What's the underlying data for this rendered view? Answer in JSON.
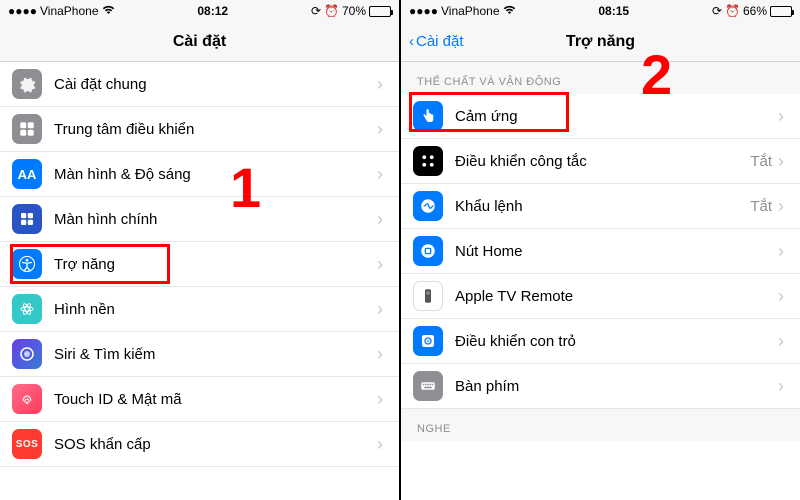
{
  "left": {
    "status": {
      "carrier": "VinaPhone",
      "time": "08:12",
      "battery_pct": "70%",
      "battery_level": 70
    },
    "nav": {
      "title": "Cài đặt"
    },
    "rows": [
      {
        "icon": "gear-icon",
        "iconClass": "icon-gray",
        "label": "Cài đặt chung"
      },
      {
        "icon": "control-center-icon",
        "iconClass": "icon-gray",
        "label": "Trung tâm điều khiển"
      },
      {
        "icon": "display-icon",
        "iconClass": "icon-blue",
        "label": "Màn hình & Độ sáng",
        "aa": true
      },
      {
        "icon": "home-screen-icon",
        "iconClass": "icon-darkblue",
        "label": "Màn hình chính"
      },
      {
        "icon": "accessibility-icon",
        "iconClass": "icon-blue",
        "label": "Trợ năng",
        "hl": true
      },
      {
        "icon": "wallpaper-icon",
        "iconClass": "icon-teal",
        "label": "Hình nền"
      },
      {
        "icon": "siri-icon",
        "iconClass": "icon-siri",
        "label": "Siri & Tìm kiếm"
      },
      {
        "icon": "touchid-icon",
        "iconClass": "icon-touch",
        "label": "Touch ID & Mật mã"
      },
      {
        "icon": "sos-icon",
        "iconClass": "icon-red",
        "label": "SOS khẩn cấp",
        "sos": true
      }
    ],
    "callout": "1"
  },
  "right": {
    "status": {
      "carrier": "VinaPhone",
      "time": "08:15",
      "battery_pct": "66%",
      "battery_level": 66
    },
    "nav": {
      "title": "Trợ năng",
      "back": "Cài đặt"
    },
    "section1": "THỂ CHẤT VÀ VẬN ĐỘNG",
    "rows1": [
      {
        "icon": "touch-icon",
        "iconClass": "icon-blue",
        "label": "Cảm ứng",
        "hl": true
      },
      {
        "icon": "switch-control-icon",
        "iconClass": "icon-black",
        "label": "Điều khiển công tắc",
        "value": "Tắt"
      },
      {
        "icon": "voice-control-icon",
        "iconClass": "icon-blue",
        "label": "Khẩu lệnh",
        "value": "Tắt"
      },
      {
        "icon": "home-button-icon",
        "iconClass": "icon-blue",
        "label": "Nút Home"
      },
      {
        "icon": "apple-tv-remote-icon",
        "iconClass": "icon-white",
        "label": "Apple TV Remote",
        "dark": true
      },
      {
        "icon": "pointer-control-icon",
        "iconClass": "icon-blue",
        "label": "Điều khiển con trỏ"
      },
      {
        "icon": "keyboard-icon",
        "iconClass": "icon-gray",
        "label": "Bàn phím"
      }
    ],
    "section2": "NGHE",
    "callout": "2"
  }
}
